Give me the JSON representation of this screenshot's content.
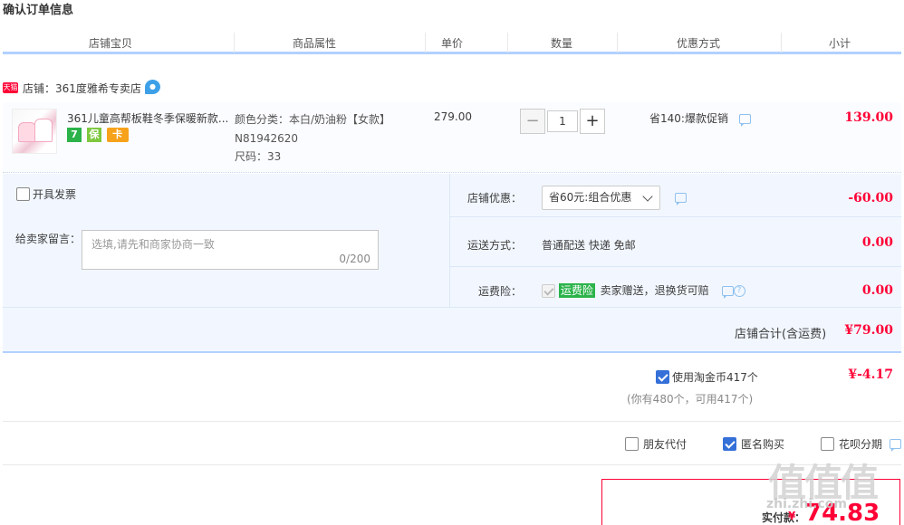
{
  "page": {
    "title": "确认订单信息"
  },
  "columns": [
    "店铺宝贝",
    "商品属性",
    "单价",
    "数量",
    "优惠方式",
    "小计"
  ],
  "shop": {
    "badge": "天猫",
    "label": "店铺：361度雅希专卖店",
    "wangwang_icon": "wangwang-chat-icon"
  },
  "item": {
    "title": "361儿童高帮板鞋冬季保暖新款...",
    "service_icons": [
      "7",
      "保",
      "卡"
    ],
    "sku_color": "颜色分类：本白/奶油粉【女款】",
    "sku_code": "N81942620",
    "sku_size": "尺码：33",
    "price": "279.00",
    "quantity": "1",
    "minus": "−",
    "plus": "+",
    "promo": "省140:爆款促销",
    "subtotal": "139.00"
  },
  "options": {
    "invoice_label": "开具发票",
    "message_label": "给卖家留言：",
    "message_placeholder": "选填,请先和商家协商一致",
    "message_count": "0/200",
    "shop_discount_label": "店铺优惠：",
    "shop_discount_selected": "省60元:组合优惠",
    "shop_discount_amount": "-60.00",
    "shipping_label": "运送方式：",
    "shipping_value": "普通配送 快递 免邮",
    "shipping_amount": "0.00",
    "insurance_label": "运费险：",
    "insurance_badge": "运费险",
    "insurance_text": "卖家赠送，退换货可赔",
    "insurance_help": "?",
    "insurance_amount": "0.00"
  },
  "shop_total": {
    "label": "店铺合计(含运费)",
    "value": "¥79.00"
  },
  "coins": {
    "label": "使用淘金币417个",
    "note": "(你有480个，可用417个)",
    "amount": "¥-4.17",
    "checked": true
  },
  "extras": [
    {
      "label": "朋友代付",
      "checked": false
    },
    {
      "label": "匿名购买",
      "checked": true
    },
    {
      "label": "花呗分期",
      "checked": false
    }
  ],
  "payment": {
    "label": "实付款：",
    "yen": "¥",
    "value": "74.83"
  },
  "watermark": {
    "logo": "值值值",
    "url": "zhi.zhi.com"
  },
  "colors": {
    "accent_red": "#ff0036",
    "header_blue": "#b2d1ff",
    "panel_bg": "#f2f7ff",
    "check_blue": "#3470d8"
  }
}
